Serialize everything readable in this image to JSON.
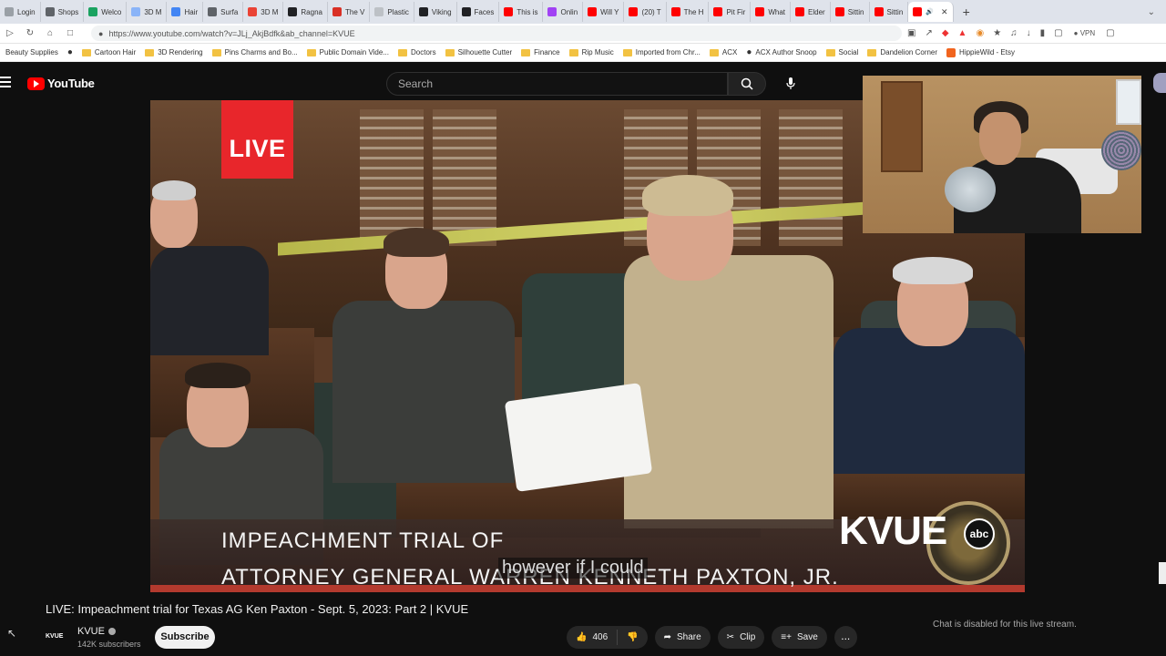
{
  "browser": {
    "tabs": [
      {
        "label": "Login",
        "color": "#9aa0a6"
      },
      {
        "label": "Shops",
        "color": "#5f6368"
      },
      {
        "label": "Welco",
        "color": "#1aa260"
      },
      {
        "label": "3D M",
        "color": "#8ab4f8"
      },
      {
        "label": "Hair",
        "color": "#4285f4"
      },
      {
        "label": "Surfa",
        "color": "#5f6368"
      },
      {
        "label": "3D M",
        "color": "#ea4335"
      },
      {
        "label": "Ragna",
        "color": "#202124"
      },
      {
        "label": "The V",
        "color": "#d93025"
      },
      {
        "label": "Plastic",
        "color": "#bdc1c6"
      },
      {
        "label": "Viking",
        "color": "#202124"
      },
      {
        "label": "Faces",
        "color": "#202124"
      },
      {
        "label": "This is",
        "color": "#ff0000"
      },
      {
        "label": "Onlin",
        "color": "#a142f4"
      },
      {
        "label": "Will Y",
        "color": "#ff0000"
      },
      {
        "label": "(20) T",
        "color": "#ff0000"
      },
      {
        "label": "The H",
        "color": "#ff0000"
      },
      {
        "label": "Pit Fir",
        "color": "#ff0000"
      },
      {
        "label": "What",
        "color": "#ff0000"
      },
      {
        "label": "Elder",
        "color": "#ff0000"
      },
      {
        "label": "Sittin",
        "color": "#ff0000"
      },
      {
        "label": "Sittin",
        "color": "#ff0000"
      }
    ],
    "active_tab_color": "#ff0000",
    "url": "https://www.youtube.com/watch?v=JLj_AkjBdfk&ab_channel=KVUE",
    "vpn_label": "VPN",
    "bookmarks": [
      {
        "label": "Beauty Supplies",
        "type": "text"
      },
      {
        "label": "",
        "type": "globe"
      },
      {
        "label": "Cartoon Hair",
        "type": "folder"
      },
      {
        "label": "3D Rendering",
        "type": "folder"
      },
      {
        "label": "Pins Charms and Bo...",
        "type": "folder"
      },
      {
        "label": "Public Domain Vide...",
        "type": "folder"
      },
      {
        "label": "Doctors",
        "type": "folder"
      },
      {
        "label": "Silhouette Cutter",
        "type": "folder"
      },
      {
        "label": "Finance",
        "type": "folder"
      },
      {
        "label": "Rip Music",
        "type": "folder"
      },
      {
        "label": "Imported from Chr...",
        "type": "folder"
      },
      {
        "label": "ACX",
        "type": "folder"
      },
      {
        "label": "ACX Author Snoop",
        "type": "globe"
      },
      {
        "label": "Social",
        "type": "folder"
      },
      {
        "label": "Dandelion Corner",
        "type": "folder"
      },
      {
        "label": "HippieWild - Etsy",
        "type": "etsy"
      }
    ]
  },
  "youtube": {
    "logo_text": "YouTube",
    "search_placeholder": "Search",
    "video": {
      "live_badge": "LIVE",
      "lower_third_line1": "IMPEACHMENT TRIAL OF",
      "lower_third_line2": "ATTORNEY GENERAL WARREN KENNETH PAXTON, JR.",
      "caption": "however if I could",
      "station_logo": "KVUE",
      "network_logo": "abc",
      "lower_third_red": "#b33a2e",
      "live_red": "#e8262b"
    },
    "title": "LIVE: Impeachment trial for Texas AG Ken Paxton - Sept. 5, 2023: Part 2 | KVUE",
    "channel": {
      "logo_text": "KVUE",
      "name": "KVUE",
      "subscribers": "142K subscribers",
      "subscribe_label": "Subscribe"
    },
    "actions": {
      "like_count": "406",
      "share_label": "Share",
      "clip_label": "Clip",
      "save_label": "Save",
      "more_label": "..."
    },
    "chat_disabled": "Chat is disabled for this live stream."
  }
}
